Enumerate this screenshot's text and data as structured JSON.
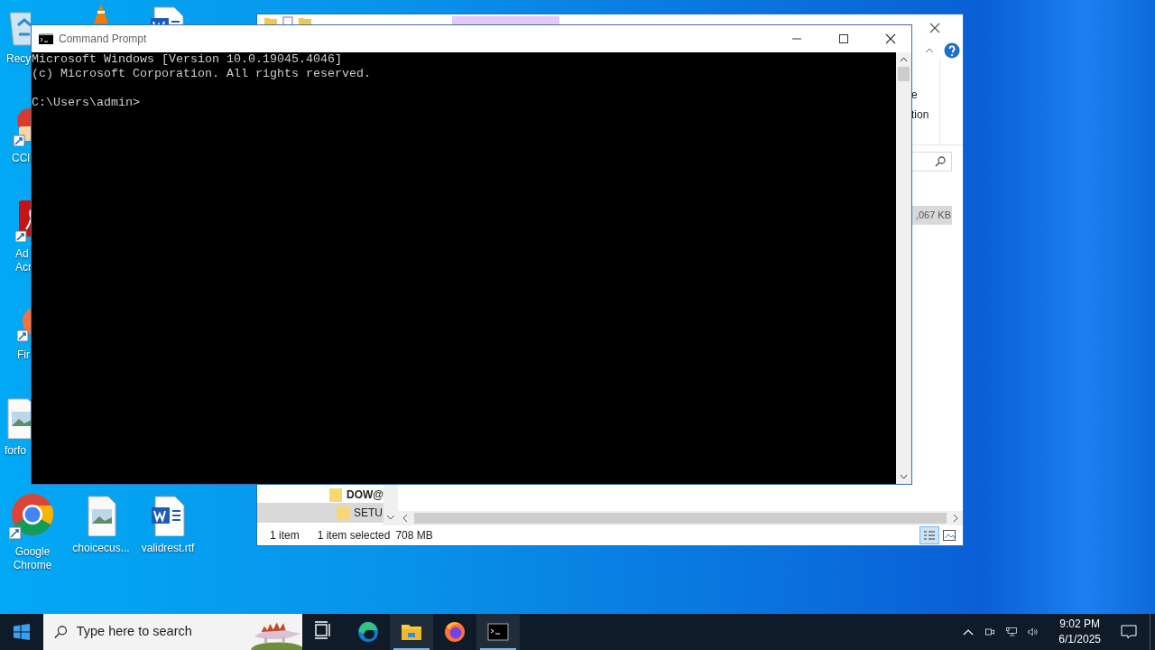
{
  "desktop_icons": [
    {
      "kind": "recycle-bin",
      "label_lines": [
        "Recy"
      ]
    },
    {
      "kind": "cone"
    },
    {
      "kind": "word"
    },
    {
      "kind": "cleaner",
      "label_lines": [
        "CCl"
      ]
    },
    {
      "kind": "acrobat",
      "label_lines": [
        "Ad",
        "Acr"
      ]
    },
    {
      "kind": "firefox",
      "label_lines": [
        "Fir"
      ]
    },
    {
      "kind": "image",
      "label_lines": [
        "forfo"
      ]
    },
    {
      "kind": "chrome",
      "label_lines": [
        "Google",
        "Chrome"
      ]
    },
    {
      "kind": "image",
      "label_lines": [
        "choicecus..."
      ]
    },
    {
      "kind": "word",
      "label_lines": [
        "validrest.rtf"
      ]
    }
  ],
  "explorer": {
    "ribbon_fragments": [
      "e",
      "tion"
    ],
    "file_rows": [
      {
        "size": ",067 KB",
        "selected": true
      }
    ],
    "tree_items": [
      {
        "label": "DOW@",
        "selected": false
      },
      {
        "label": "SETU",
        "selected": true
      }
    ],
    "status": {
      "items": "1 item",
      "selection": "1 item selected",
      "size": "708 MB"
    }
  },
  "console": {
    "title": "Command Prompt",
    "output": [
      "Microsoft Windows [Version 10.0.19045.4046]",
      "(c) Microsoft Corporation. All rights reserved."
    ],
    "prompt": "C:\\Users\\admin>"
  },
  "taskbar": {
    "search": {
      "placeholder": "Type here to search"
    },
    "apps": [
      {
        "kind": "task-view",
        "active": false
      },
      {
        "kind": "edge",
        "active": false
      },
      {
        "kind": "explorer",
        "active": true
      },
      {
        "kind": "firefox",
        "active": false
      },
      {
        "kind": "console",
        "active": true
      }
    ],
    "clock": {
      "time": "9:02 PM",
      "date": "6/1/2025"
    }
  }
}
